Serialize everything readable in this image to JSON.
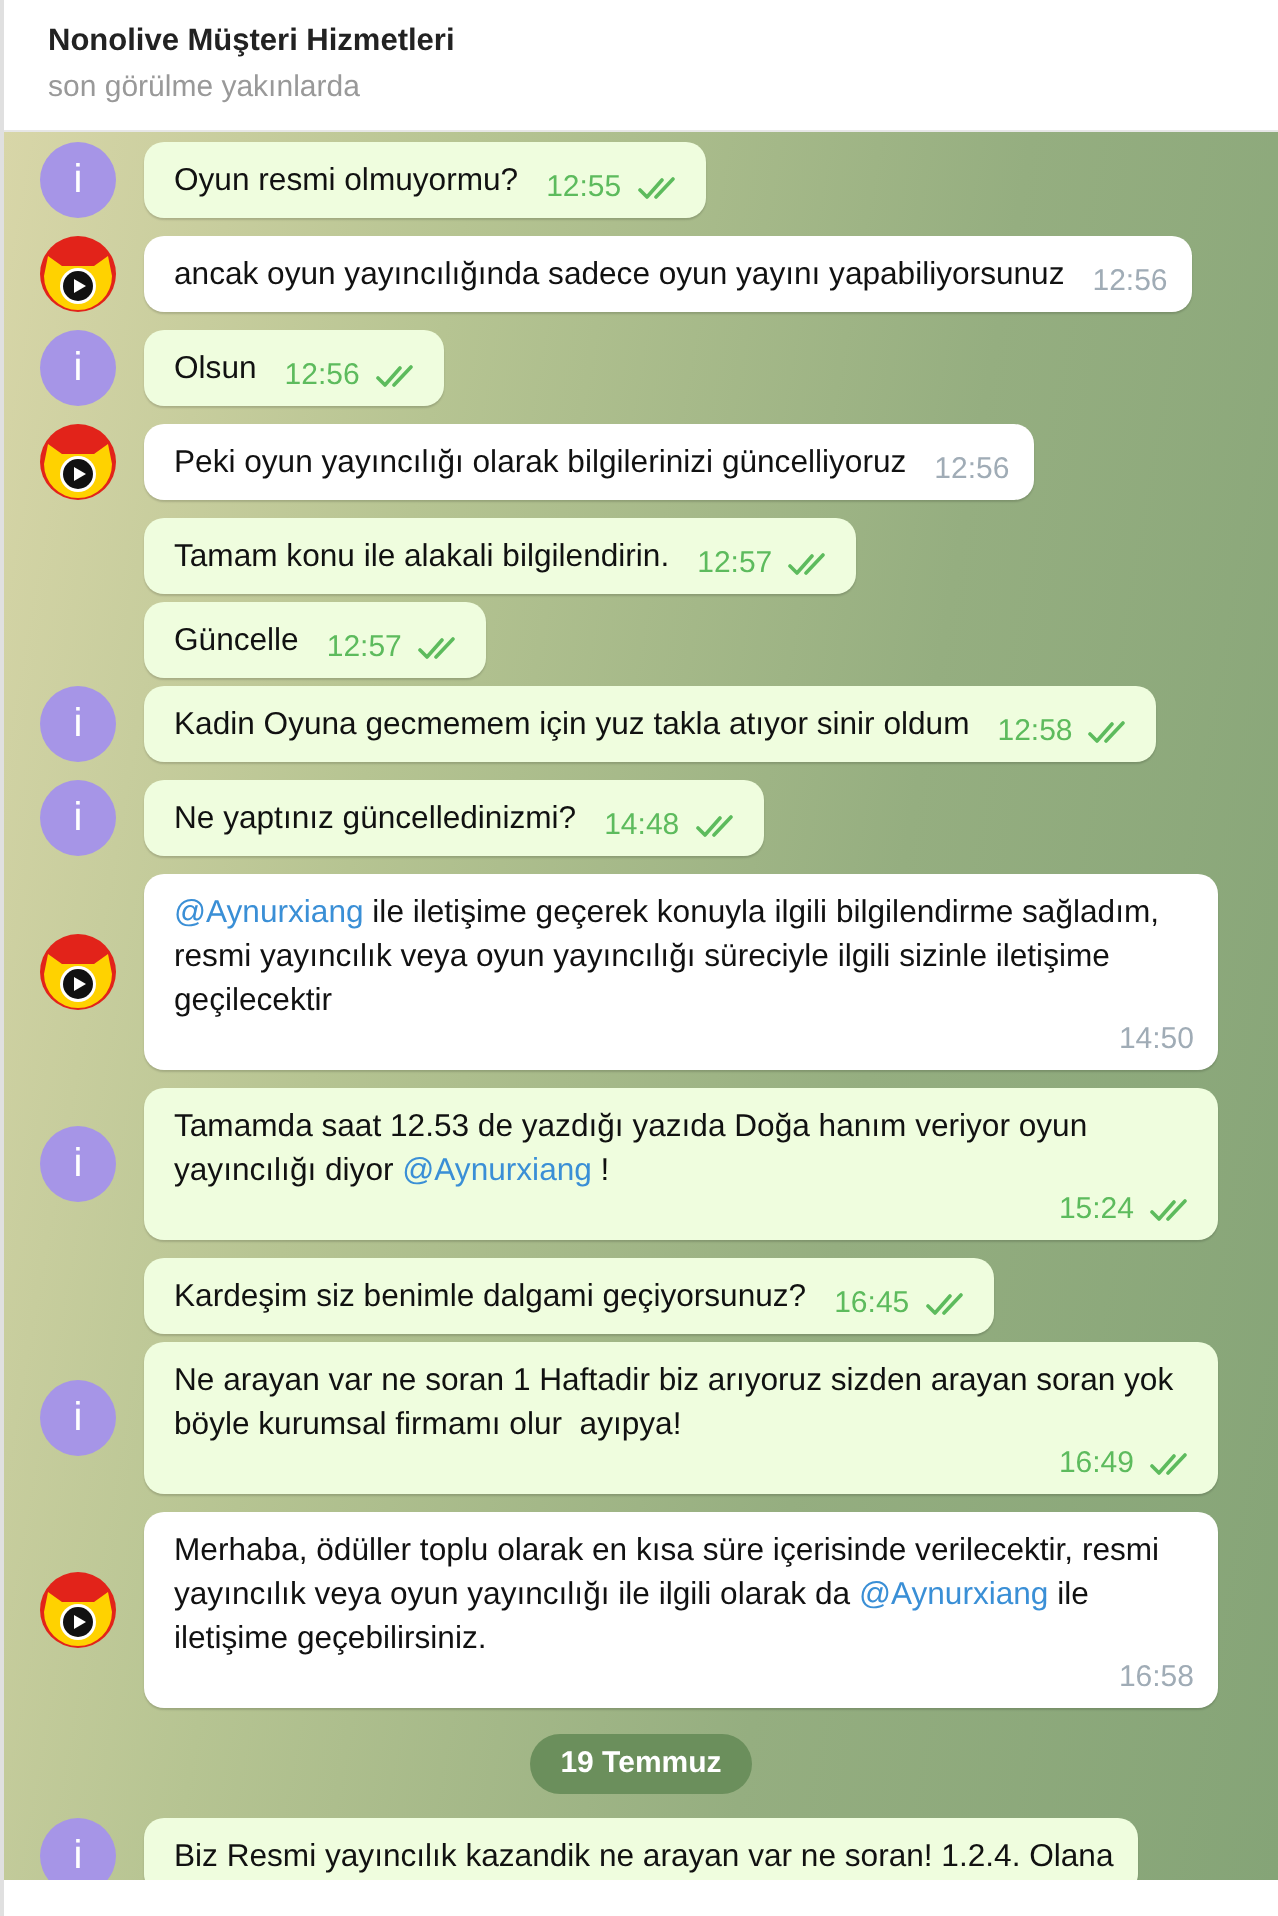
{
  "header": {
    "title": "Nonolive Müşteri Hizmetleri",
    "subtitle": "son görülme yakınlarda"
  },
  "timeline": [
    {
      "kind": "outgoing",
      "avatar": "i",
      "show_avatar": true,
      "parts": [
        {
          "kind": "text",
          "text": "Oyun resmi olmuyormu?"
        }
      ],
      "time": "12:55",
      "read": true
    },
    {
      "kind": "incoming",
      "show_avatar": true,
      "parts": [
        {
          "kind": "text",
          "text": "ancak oyun yayıncılığında sadece oyun yayını yapabiliyorsunuz"
        }
      ],
      "time": "12:56"
    },
    {
      "kind": "outgoing",
      "avatar": "i",
      "show_avatar": true,
      "parts": [
        {
          "kind": "text",
          "text": "Olsun"
        }
      ],
      "time": "12:56",
      "read": true
    },
    {
      "kind": "incoming",
      "show_avatar": true,
      "parts": [
        {
          "kind": "text",
          "text": "Peki oyun yayıncılığı olarak bilgilerinizi güncelliyoruz"
        }
      ],
      "time": "12:56"
    },
    {
      "kind": "outgoing",
      "show_avatar": false,
      "parts": [
        {
          "kind": "text",
          "text": "Tamam konu ile alakali bilgilendirin."
        }
      ],
      "time": "12:57",
      "read": true
    },
    {
      "kind": "outgoing",
      "show_avatar": false,
      "parts": [
        {
          "kind": "text",
          "text": "Güncelle"
        }
      ],
      "time": "12:57",
      "read": true
    },
    {
      "kind": "outgoing",
      "avatar": "i",
      "show_avatar": true,
      "parts": [
        {
          "kind": "text",
          "text": "Kadin Oyuna gecmemem için yuz takla atıyor sinir oldum"
        }
      ],
      "time": "12:58",
      "read": true
    },
    {
      "kind": "outgoing",
      "avatar": "i",
      "show_avatar": true,
      "parts": [
        {
          "kind": "text",
          "text": "Ne yaptınız güncelledinizmi?"
        }
      ],
      "time": "14:48",
      "read": true
    },
    {
      "kind": "incoming",
      "show_avatar": true,
      "parts": [
        {
          "kind": "mention",
          "text": "@Aynurxiang"
        },
        {
          "kind": "text",
          "text": " ile iletişime geçerek konuyla ilgili bilgilendirme sağladım, resmi yayıncılık veya oyun yayıncılığı süreciyle ilgili sizinle iletişime geçilecektir"
        }
      ],
      "time": "14:50"
    },
    {
      "kind": "outgoing",
      "avatar": "i",
      "show_avatar": true,
      "parts": [
        {
          "kind": "text",
          "text": "Tamamda saat 12.53 de yazdığı yazıda Doğa hanım veriyor oyun yayıncılığı diyor "
        },
        {
          "kind": "mention",
          "text": "@Aynurxiang"
        },
        {
          "kind": "text",
          "text": " !"
        }
      ],
      "time": "15:24",
      "read": true
    },
    {
      "kind": "outgoing",
      "show_avatar": false,
      "parts": [
        {
          "kind": "text",
          "text": "Kardeşim siz benimle dalgami geçiyorsunuz?"
        }
      ],
      "time": "16:45",
      "read": true
    },
    {
      "kind": "outgoing",
      "avatar": "i",
      "show_avatar": true,
      "parts": [
        {
          "kind": "text",
          "text": "Ne arayan var ne soran 1 Haftadir biz arıyoruz sizden arayan soran yok böyle kurumsal firmamı olur  ayıpya!"
        }
      ],
      "time": "16:49",
      "read": true
    },
    {
      "kind": "incoming",
      "show_avatar": true,
      "parts": [
        {
          "kind": "text",
          "text": "Merhaba, ödüller toplu olarak en kısa süre içerisinde verilecektir, resmi yayıncılık veya oyun yayıncılığı ile ilgili olarak da "
        },
        {
          "kind": "mention",
          "text": "@Aynurxiang"
        },
        {
          "kind": "text",
          "text": " ile iletişime geçebilirsiniz."
        }
      ],
      "time": "16:58"
    },
    {
      "kind": "date",
      "text": "19 Temmuz"
    },
    {
      "kind": "outgoing",
      "avatar": "i",
      "show_avatar": true,
      "parts": [
        {
          "kind": "text",
          "text": "Biz Resmi yayıncılık kazandik ne arayan var ne soran! 1.2.4. Olana"
        }
      ]
    }
  ]
}
